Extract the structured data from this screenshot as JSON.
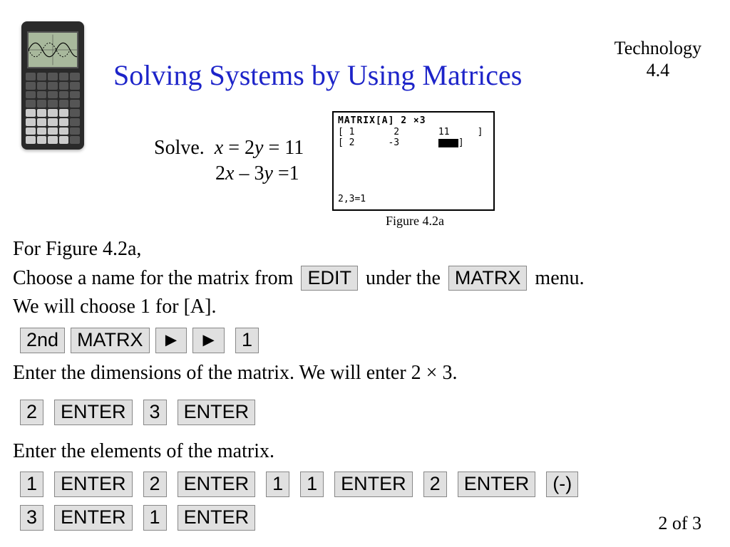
{
  "header": {
    "title": "Solving Systems by Using Matrices",
    "tech_label_line1": "Technology",
    "tech_label_line2": "4.4"
  },
  "problem": {
    "solve_label": "Solve.",
    "eq1_pre": "x",
    "eq1_mid": " = 2",
    "eq1_y": "y",
    "eq1_post": " = 11",
    "eq2_pre": "2",
    "eq2_x": "x",
    "eq2_mid": " – 3",
    "eq2_y": "y",
    "eq2_post": " =1"
  },
  "figure": {
    "screen_header": "MATRIX[A] 2 ×3",
    "row1": "[ 1       2       11     ]",
    "row2": "[ 2      -3       ",
    "row2_end": "]",
    "bottom": "2,3=1",
    "caption": "Figure 4.2a"
  },
  "instructions": {
    "line1": "For Figure 4.2a,",
    "line2_a": "Choose a name for the matrix from ",
    "edit_key": "EDIT",
    "line2_b": " under the ",
    "matrx_key": "MATRX",
    "line2_c": "  menu.",
    "line3": "We will choose 1 for [A].",
    "seq1": [
      "2nd",
      "MATRX",
      "►",
      "►",
      "1"
    ],
    "line4": "Enter the dimensions of the matrix. We will enter 2 × 3.",
    "seq2": [
      "2",
      "ENTER",
      "3",
      "ENTER"
    ],
    "line5": "Enter the elements of the matrix.",
    "seq3": [
      "1",
      "ENTER",
      "2",
      "ENTER",
      "1",
      "1",
      "ENTER",
      "2",
      "ENTER",
      "(-)"
    ],
    "seq4": [
      "3",
      "ENTER",
      "1",
      "ENTER"
    ]
  },
  "pagenum": "2 of 3"
}
